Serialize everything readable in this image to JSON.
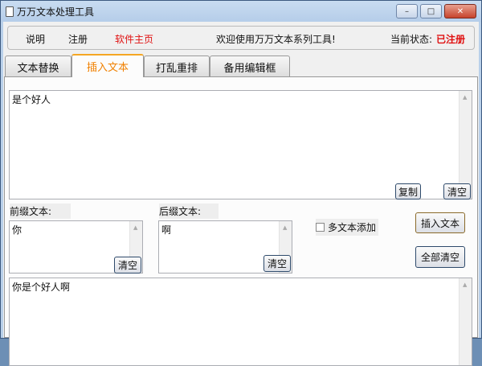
{
  "window": {
    "title": "万万文本处理工具",
    "minimize": "–",
    "maximize": "□",
    "close": "✕"
  },
  "header": {
    "help": "说明",
    "register": "注册",
    "homepage": "软件主页",
    "welcome": "欢迎使用万万文本系列工具!",
    "status_label": "当前状态:",
    "status_value": "已注册"
  },
  "tabs": [
    {
      "label": "文本替换"
    },
    {
      "label": "插入文本"
    },
    {
      "label": "打乱重排"
    },
    {
      "label": "备用编辑框"
    }
  ],
  "main": {
    "source_text": "是个好人",
    "copy_button": "复制",
    "clear_button": "清空",
    "prefix_label": "前缀文本:",
    "prefix_value": "你",
    "suffix_label": "后缀文本:",
    "suffix_value": "啊",
    "multi_text_label": "多文本添加",
    "multi_text_checked": false,
    "insert_button": "插入文本",
    "clear_all_button": "全部清空",
    "result_text": "你是个好人啊"
  }
}
